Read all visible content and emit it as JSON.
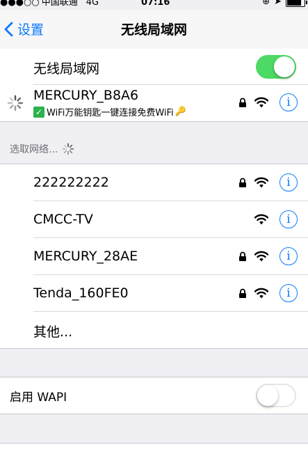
{
  "status": {
    "carrier": "中国联通",
    "network": "4G",
    "time": "07:16"
  },
  "nav": {
    "back_label": "设置",
    "title": "无线局域网"
  },
  "wifi_toggle": {
    "label": "无线局域网",
    "on": true
  },
  "connected": {
    "ssid": "MERCURY_B8A6",
    "subtitle": "WiFi万能钥匙一键连接免费WiFi",
    "secured": true
  },
  "section_header": "选取网络...",
  "networks": [
    {
      "ssid": "222222222",
      "secured": true
    },
    {
      "ssid": "CMCC-TV",
      "secured": false
    },
    {
      "ssid": "MERCURY_28AE",
      "secured": true
    },
    {
      "ssid": "Tenda_160FE0",
      "secured": true
    }
  ],
  "other_label": "其他...",
  "wapi": {
    "label": "启用 WAPI",
    "on": false
  },
  "colors": {
    "accent": "#0a7aff",
    "switch_on": "#4cd964",
    "background": "#efeff4"
  },
  "icons": [
    "back-chevron-icon",
    "lock-icon",
    "wifi-icon",
    "info-icon",
    "spinner-icon",
    "key-icon",
    "checkmark-icon"
  ]
}
